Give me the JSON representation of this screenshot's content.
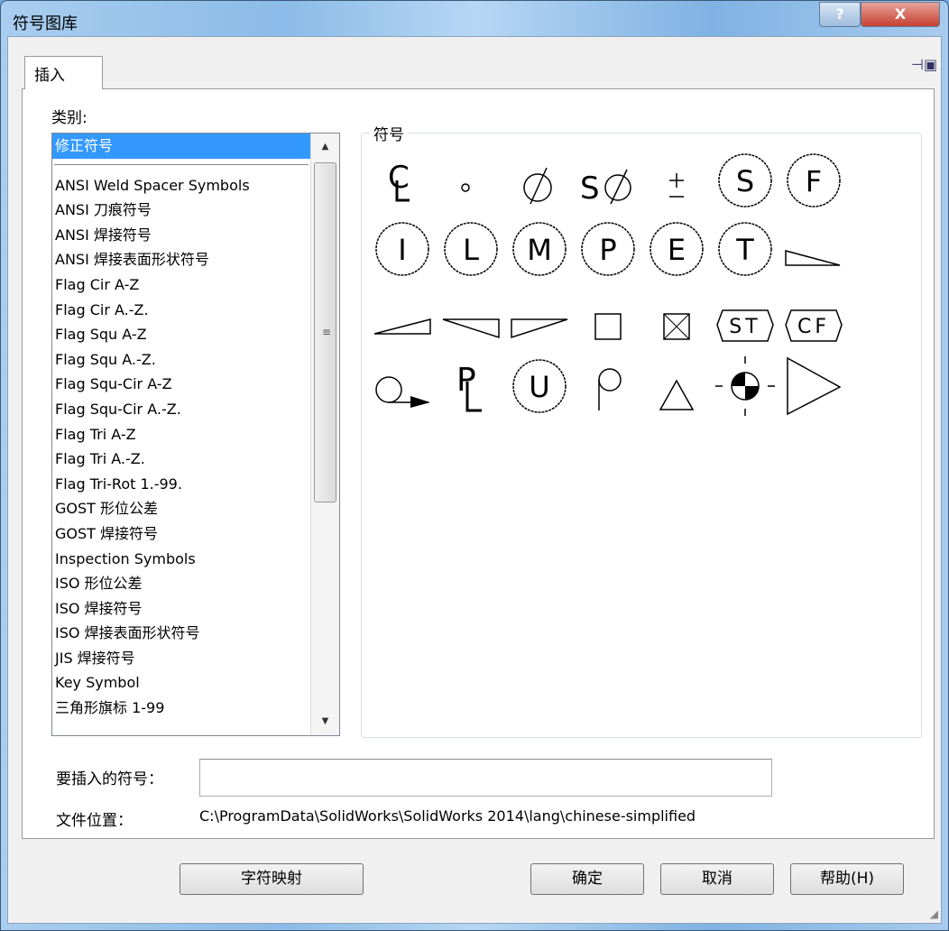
{
  "window": {
    "title": "符号图库",
    "help": "?",
    "close": "X"
  },
  "tab": {
    "label": "插入"
  },
  "category": {
    "label": "类别:",
    "selected": "修正符号",
    "items": [
      "ANSI Weld Spacer Symbols",
      "ANSI 刀痕符号",
      "ANSI 焊接符号",
      "ANSI 焊接表面形状符号",
      "Flag Cir A-Z",
      "Flag Cir A.-Z.",
      "Flag Squ A-Z",
      "Flag Squ A.-Z.",
      "Flag Squ-Cir A-Z",
      "Flag Squ-Cir A.-Z.",
      "Flag Tri A-Z",
      "Flag Tri A.-Z.",
      "Flag Tri-Rot 1.-99.",
      "GOST 形位公差",
      "GOST 焊接符号",
      "Inspection Symbols",
      "ISO 形位公差",
      "ISO 焊接符号",
      "ISO 焊接表面形状符号",
      "JIS 焊接符号",
      "Key Symbol",
      "三角形旗标 1-99"
    ]
  },
  "symbols": {
    "label": "符号",
    "letters": {
      "s": "S",
      "f": "F",
      "i": "I",
      "l": "L",
      "m": "M",
      "p": "P",
      "e": "E",
      "t": "T",
      "u": "U",
      "st": "ST",
      "cf": "CF",
      "sdia": "S"
    }
  },
  "insert": {
    "label": "要插入的符号：",
    "value": ""
  },
  "file": {
    "label": "文件位置：",
    "path": "C:\\ProgramData\\SolidWorks\\SolidWorks 2014\\lang\\chinese-simplified"
  },
  "buttons": {
    "charmap": "字符映射",
    "ok": "确定",
    "cancel": "取消",
    "help": "帮助(H)"
  }
}
